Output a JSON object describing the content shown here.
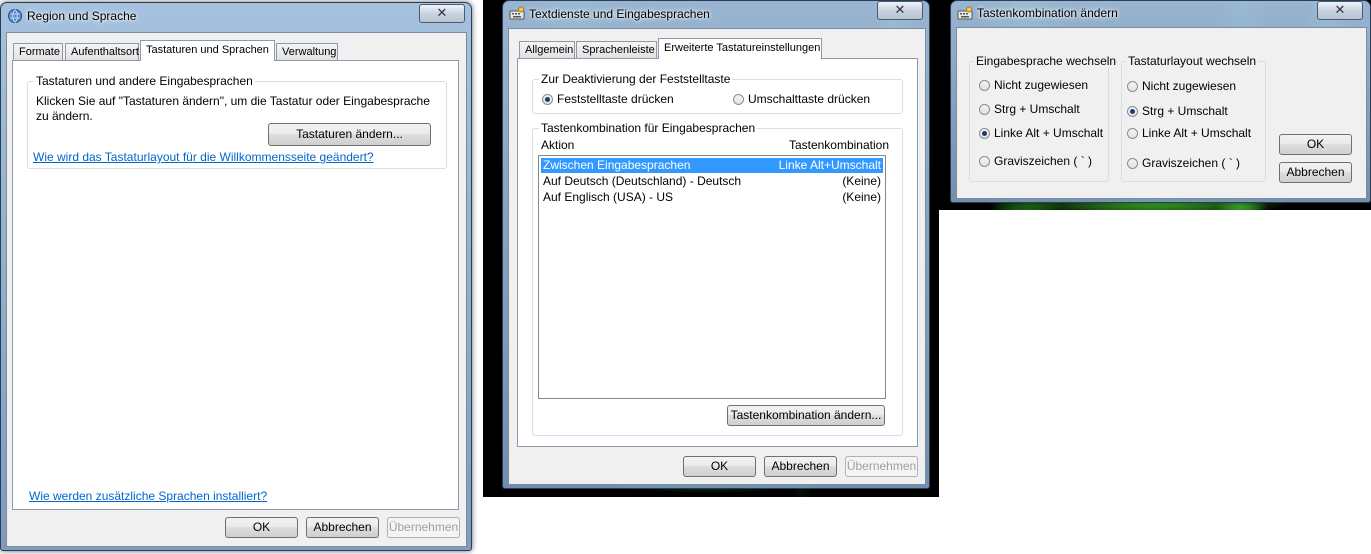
{
  "win1": {
    "title": "Region und Sprache",
    "close": "✕",
    "tabs": [
      "Formate",
      "Aufenthaltsort",
      "Tastaturen und Sprachen",
      "Verwaltung"
    ],
    "group_title": "Tastaturen und andere Eingabesprachen",
    "desc_line1": "Klicken Sie auf \"Tastaturen ändern\", um die Tastatur oder Eingabesprache",
    "desc_line2": "zu ändern.",
    "change_keyboards": "Tastaturen ändern...",
    "welcome_link": "Wie wird das Tastaturlayout für die Willkommensseite geändert?",
    "languages_link": "Wie werden zusätzliche Sprachen installiert?",
    "ok": "OK",
    "cancel": "Abbrechen",
    "apply": "Übernehmen"
  },
  "win2": {
    "title": "Textdienste und Eingabesprachen",
    "close": "✕",
    "tabs": [
      "Allgemein",
      "Sprachenleiste",
      "Erweiterte Tastatureinstellungen"
    ],
    "caps_group": "Zur Deaktivierung der Feststelltaste",
    "caps_option1": "Feststelltaste drücken",
    "caps_option2": "Umschalttaste drücken",
    "hotkey_group": "Tastenkombination für Eingabesprachen",
    "col_action": "Aktion",
    "col_hotkey": "Tastenkombination",
    "rows": [
      {
        "action": "Zwischen Eingabesprachen",
        "hotkey": "Linke Alt+Umschalt"
      },
      {
        "action": "Auf Deutsch (Deutschland) - Deutsch",
        "hotkey": "(Keine)"
      },
      {
        "action": "Auf Englisch (USA) - US",
        "hotkey": "(Keine)"
      }
    ],
    "change_hotkey": "Tastenkombination ändern...",
    "ok": "OK",
    "cancel": "Abbrechen",
    "apply": "Übernehmen"
  },
  "win3": {
    "title": "Tastenkombination ändern",
    "close": "✕",
    "group_lang": "Eingabesprache wechseln",
    "group_layout": "Tastaturlayout wechseln",
    "lang_options": [
      "Nicht zugewiesen",
      "Strg + Umschalt",
      "Linke Alt + Umschalt",
      "Graviszeichen ( ` )"
    ],
    "layout_options": [
      "Nicht zugewiesen",
      "Strg + Umschalt",
      "Linke Alt + Umschalt",
      "Graviszeichen ( ` )"
    ],
    "lang_selected": 2,
    "layout_selected": 1,
    "ok": "OK",
    "cancel": "Abbrechen"
  }
}
